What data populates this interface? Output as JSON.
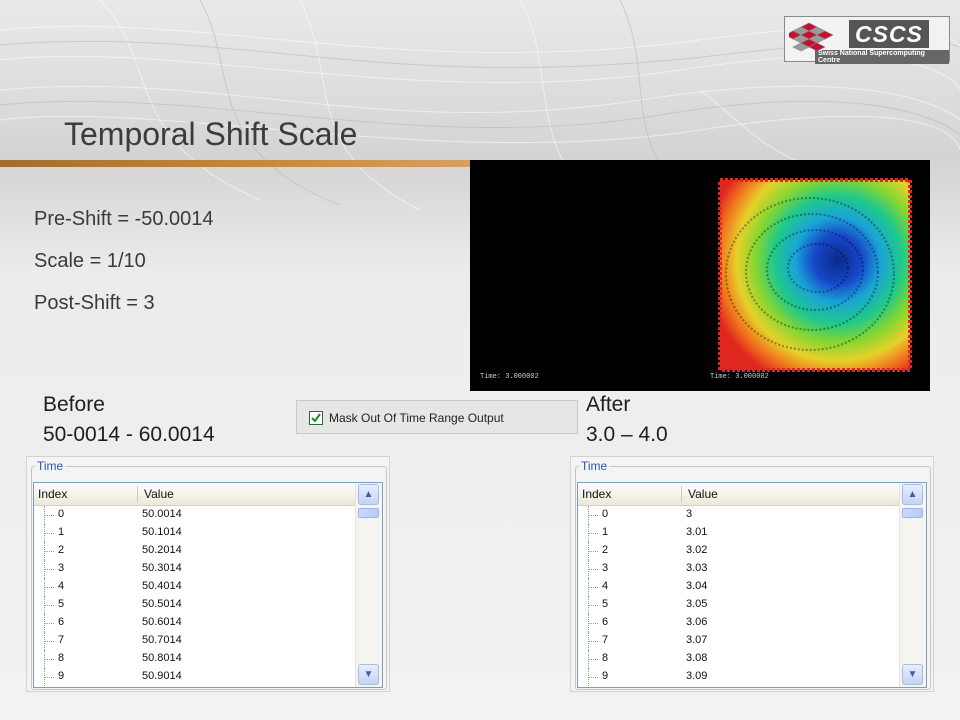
{
  "slide": {
    "title": "Temporal Shift Scale",
    "params": [
      "Pre-Shift = -50.0014",
      "Scale = 1/10",
      "Post-Shift = 3"
    ]
  },
  "logo": {
    "name": "CSCS",
    "subtitle": "Swiss National Supercomputing Centre"
  },
  "viz": {
    "left_time": "Time: 3.000002",
    "right_time": "Time: 3.000002"
  },
  "mask_option": {
    "label": "Mask Out Of Time Range Output",
    "checked": true
  },
  "before": {
    "label": "Before",
    "range": "50-0014 - 60.0014"
  },
  "after": {
    "label": "After",
    "range": "3.0 – 4.0"
  },
  "before_table": {
    "group_title": "Time",
    "columns": [
      "Index",
      "Value"
    ],
    "rows": [
      [
        "0",
        "50.0014"
      ],
      [
        "1",
        "50.1014"
      ],
      [
        "2",
        "50.2014"
      ],
      [
        "3",
        "50.3014"
      ],
      [
        "4",
        "50.4014"
      ],
      [
        "5",
        "50.5014"
      ],
      [
        "6",
        "50.6014"
      ],
      [
        "7",
        "50.7014"
      ],
      [
        "8",
        "50.8014"
      ],
      [
        "9",
        "50.9014"
      ]
    ]
  },
  "after_table": {
    "group_title": "Time",
    "columns": [
      "Index",
      "Value"
    ],
    "rows": [
      [
        "0",
        "3"
      ],
      [
        "1",
        "3.01"
      ],
      [
        "2",
        "3.02"
      ],
      [
        "3",
        "3.03"
      ],
      [
        "4",
        "3.04"
      ],
      [
        "5",
        "3.05"
      ],
      [
        "6",
        "3.06"
      ],
      [
        "7",
        "3.07"
      ],
      [
        "8",
        "3.08"
      ],
      [
        "9",
        "3.09"
      ]
    ]
  },
  "colors": {
    "accent_line": "#b57a32",
    "group_title": "#2f53b0",
    "viz_bg": "#000000"
  }
}
